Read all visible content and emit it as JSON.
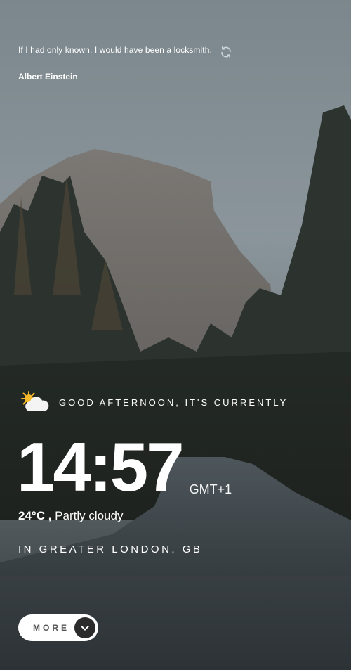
{
  "quote": {
    "text": "If I had only known, I would have been a locksmith.",
    "author": "Albert Einstein"
  },
  "greeting": {
    "text": "Good afternoon, it's currently",
    "icon": "partly-cloudy-day-icon"
  },
  "clock": {
    "time": "14:57",
    "timezone": "GMT+1"
  },
  "weather": {
    "temperature": "24°C",
    "separator": " ,",
    "condition": " Partly cloudy"
  },
  "location": {
    "text": "In Greater London, GB"
  },
  "more_button": {
    "label": "More"
  },
  "colors": {
    "text": "#ffffff",
    "button_bg": "#ffffff",
    "button_text": "#555555",
    "arrow_circle": "#2b2b2b"
  }
}
